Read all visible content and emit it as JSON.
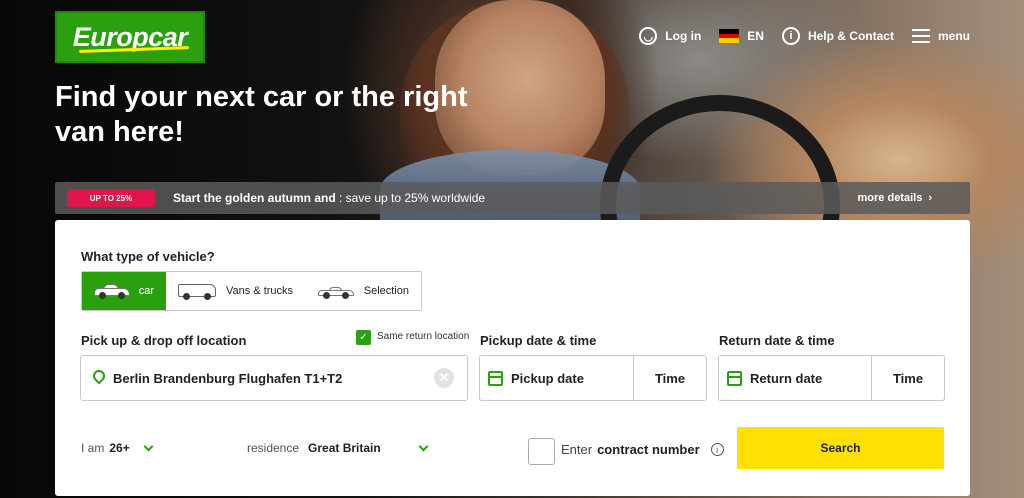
{
  "brand": {
    "logo_text": "Europcar",
    "accent": "#2aa00f",
    "cta": "#ffe000",
    "badge": "#e0154a"
  },
  "nav": {
    "login_label": "Log in",
    "lang_label": "EN",
    "help_label": "Help & Contact",
    "menu_label": "menu"
  },
  "hero": {
    "headline": "Find your next car or the right van here!"
  },
  "promo": {
    "badge": "UP TO 25%",
    "text_bold": "Start the golden autumn and",
    "text_rest": " : save up to 25% worldwide",
    "more_label": "more details"
  },
  "search": {
    "vehicle_question": "What type of vehicle?",
    "vehicle_types": [
      {
        "label": "car",
        "icon": "car-icon",
        "active": true
      },
      {
        "label": "Vans & trucks",
        "icon": "van-icon",
        "active": false
      },
      {
        "label": "Selection",
        "icon": "sports-car-icon",
        "active": false
      }
    ],
    "location_label": "Pick up & drop off location",
    "same_return_label": "Same return location",
    "same_return_checked": true,
    "location_value": "Berlin Brandenburg Flughafen T1+T2",
    "pickup_label": "Pickup date & time",
    "pickup_date_placeholder": "Pickup date",
    "pickup_time_placeholder": "Time",
    "return_label": "Return date & time",
    "return_date_placeholder": "Return date",
    "return_time_placeholder": "Time",
    "age_prefix": "I am",
    "age_value": "26+",
    "residence_prefix": "residence",
    "residence_value": "Great Britain",
    "contract_prefix": "Enter",
    "contract_bold": "contract number",
    "search_label": "Search"
  }
}
